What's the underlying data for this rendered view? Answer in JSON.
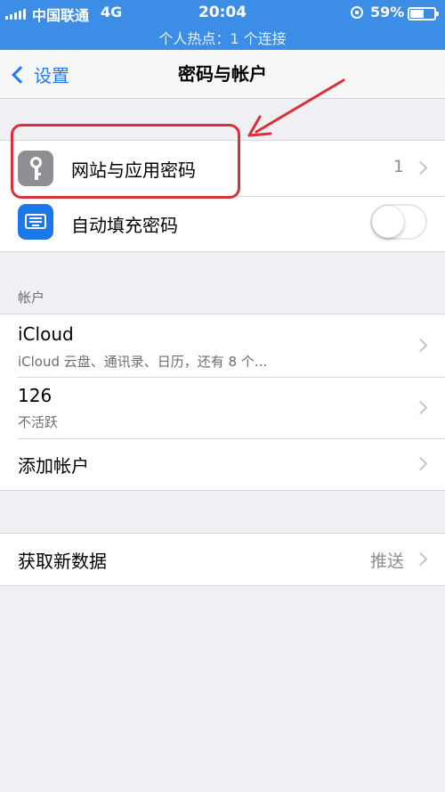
{
  "status_bar": {
    "carrier": "中国联通",
    "network": "4G",
    "time": "20:04",
    "battery": "59%",
    "battery_level": 0.59,
    "hotspot": "个人热点：1 个连接"
  },
  "nav": {
    "back_label": "设置",
    "title": "密码与帐户"
  },
  "passwords_group": {
    "items": [
      {
        "label": "网站与应用密码",
        "value": "1",
        "icon": "key-icon"
      },
      {
        "label": "自动填充密码",
        "icon": "keyboard-icon",
        "toggle_on": false
      }
    ]
  },
  "accounts_group": {
    "header": "帐户",
    "items": [
      {
        "title": "iCloud",
        "subtitle": "iCloud 云盘、通讯录、日历，还有 8 个..."
      },
      {
        "title": "126",
        "subtitle": "不活跃"
      },
      {
        "title": "添加帐户"
      }
    ]
  },
  "fetch_group": {
    "label": "获取新数据",
    "value": "推送"
  },
  "colors": {
    "status_bar": "#3b8de6",
    "accent": "#1e7cf0",
    "annotation": "#d9303a"
  }
}
